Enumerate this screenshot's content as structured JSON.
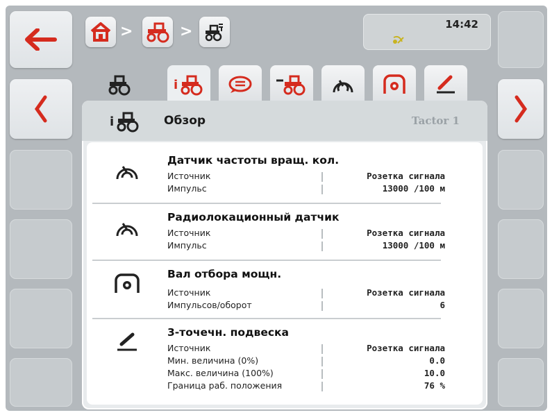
{
  "clock": {
    "time": "14:42"
  },
  "panel": {
    "title": "Обзор",
    "tractor_name": "Tactor 1"
  },
  "sections": [
    {
      "icon": "wheel-speed-sensor-icon",
      "title": "Датчик частоты вращ. кол.",
      "rows": [
        {
          "label": "Источник",
          "value": "Розетка сигнала"
        },
        {
          "label": "Импульс",
          "value": "13000 /100 м"
        }
      ]
    },
    {
      "icon": "radar-sensor-icon",
      "title": "Радиолокационный датчик",
      "rows": [
        {
          "label": "Источник",
          "value": "Розетка сигнала"
        },
        {
          "label": "Импульс",
          "value": "13000 /100 м"
        }
      ]
    },
    {
      "icon": "pto-icon",
      "title": "Вал отбора мощн.",
      "rows": [
        {
          "label": "Источник",
          "value": "Розетка сигнала"
        },
        {
          "label": "Импульсов/оборот",
          "value": "6"
        }
      ]
    },
    {
      "icon": "three-point-hitch-icon",
      "title": "3-точечн. подвеска",
      "rows": [
        {
          "label": "Источник",
          "value": "Розетка сигнала"
        },
        {
          "label": "Мин. величина (0%)",
          "value": "0.0"
        },
        {
          "label": "Макс. величина (100%)",
          "value": "10.0"
        },
        {
          "label": "Граница раб. положения",
          "value": "76 %"
        }
      ]
    }
  ],
  "tabs": [
    "tractor-icon",
    "tractor-info-icon",
    "speech-icon",
    "tractor-connect-icon",
    "speed-sensor-icon",
    "pto-icon",
    "hitch-icon"
  ],
  "colors": {
    "accent_red": "#d52b1e",
    "frame": "#b4b9bd"
  }
}
